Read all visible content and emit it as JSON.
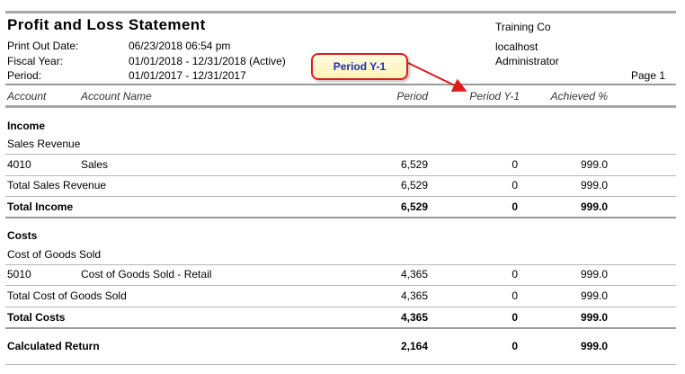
{
  "report": {
    "title": "Profit and Loss Statement",
    "company": "Training Co",
    "host": "localhost",
    "user": "Administrator",
    "page": "Page 1",
    "info": [
      {
        "label": "Print Out Date:",
        "value": "06/23/2018   06:54 pm"
      },
      {
        "label": "Fiscal Year:",
        "value": "01/01/2018 - 12/31/2018  (Active)"
      },
      {
        "label": "Period:",
        "value": "01/01/2017 - 12/31/2017"
      }
    ]
  },
  "columns": {
    "account": "Account",
    "account_name": "Account Name",
    "period": "Period",
    "period_y1": "Period Y-1",
    "achieved": "Achieved %"
  },
  "income": {
    "heading": "Income",
    "group": "Sales Revenue",
    "line": {
      "account": "4010",
      "name": "Sales",
      "period": "6,529",
      "period_y1": "0",
      "achieved": "999.0"
    },
    "group_total": {
      "label": "Total Sales Revenue",
      "period": "6,529",
      "period_y1": "0",
      "achieved": "999.0"
    },
    "total": {
      "label": "Total Income",
      "period": "6,529",
      "period_y1": "0",
      "achieved": "999.0"
    }
  },
  "costs": {
    "heading": "Costs",
    "group": "Cost of Goods Sold",
    "line": {
      "account": "5010",
      "name": "Cost of Goods Sold - Retail",
      "period": "4,365",
      "period_y1": "0",
      "achieved": "999.0"
    },
    "group_total": {
      "label": "Total Cost of Goods Sold",
      "period": "4,365",
      "period_y1": "0",
      "achieved": "999.0"
    },
    "total": {
      "label": "Total Costs",
      "period": "4,365",
      "period_y1": "0",
      "achieved": "999.0"
    }
  },
  "calculated": {
    "label": "Calculated Return",
    "period": "2,164",
    "period_y1": "0",
    "achieved": "999.0"
  },
  "callout": {
    "text": "Period Y-1",
    "border_color": "#e01b1b",
    "text_color": "#1b2db5"
  }
}
